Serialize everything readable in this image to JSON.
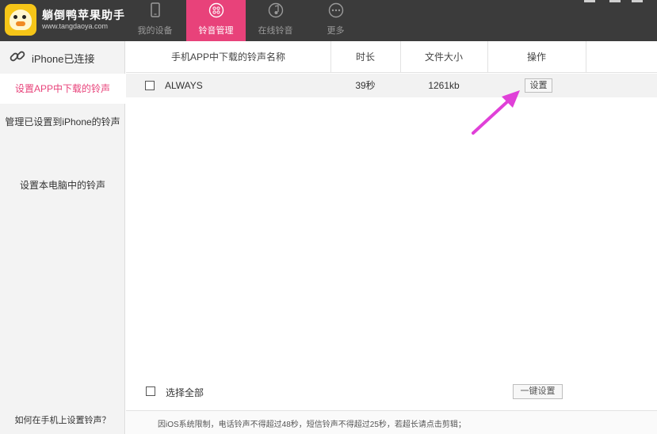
{
  "brand": {
    "title": "躺倒鸭苹果助手",
    "url": "www.tangdaoya.com"
  },
  "nav_tabs": [
    {
      "label": "我的设备",
      "icon": "phone-icon",
      "active": false
    },
    {
      "label": "铃音管理",
      "icon": "ringtone-icon",
      "active": true
    },
    {
      "label": "在线铃音",
      "icon": "music-note-icon",
      "active": false
    },
    {
      "label": "更多",
      "icon": "more-icon",
      "active": false
    }
  ],
  "sidebar": {
    "connection_status": "iPhone已连接",
    "items": [
      {
        "label": "设置APP中下载的铃声",
        "active": true
      },
      {
        "label": "管理已设置到iPhone的铃声",
        "active": false
      },
      {
        "label": "设置本电脑中的铃声",
        "active": false
      }
    ],
    "help_link": "如何在手机上设置铃声？"
  },
  "table": {
    "columns": [
      "手机APP中下载的铃声名称",
      "时长",
      "文件大小",
      "操作"
    ],
    "rows": [
      {
        "name": "ALWAYS",
        "duration": "39秒",
        "size": "1261kb",
        "action": "设置",
        "checked": false
      }
    ]
  },
  "footer": {
    "select_all_label": "选择全部",
    "one_click_button": "一键设置",
    "notice": "因iOS系统限制，电话铃声不得超过48秒，短信铃声不得超过25秒，若超长请点击剪辑；"
  },
  "colors": {
    "accent": "#e8427a",
    "topbar": "#3b3b3b",
    "arrow": "#e040d8"
  }
}
